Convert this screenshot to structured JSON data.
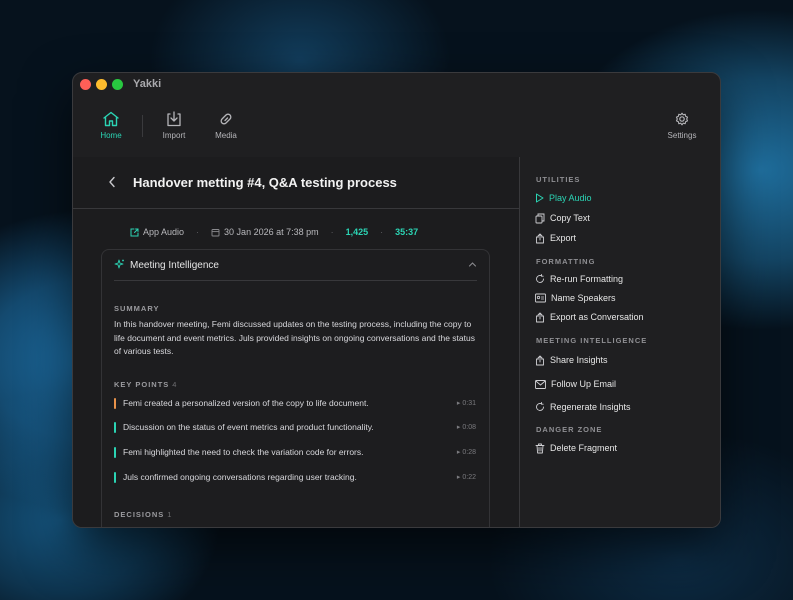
{
  "app": {
    "title": "Yakki"
  },
  "toolbar": {
    "home": "Home",
    "import": "Import",
    "media": "Media",
    "settings": "Settings"
  },
  "header": {
    "title": "Handover metting #4, Q&A testing process"
  },
  "meta": {
    "source": "App Audio",
    "date": "30 Jan 2026 at 7:38 pm",
    "words": "1,425",
    "duration": "35:37"
  },
  "intel": {
    "title": "Meeting Intelligence",
    "summary_label": "SUMMARY",
    "summary": "In this handover meeting, Femi discussed updates on the testing process, including the copy to life document and event metrics. Juls provided insights on ongoing conversations and the status of various tests.",
    "keypoints_label": "KEY POINTS",
    "keypoints_count": "4",
    "keypoints": [
      {
        "text": "Femi created a personalized version of the copy to life document.",
        "time": "0:31",
        "color": "#e8924a"
      },
      {
        "text": "Discussion on the status of event metrics and product functionality.",
        "time": "0:08",
        "color": "#2bd4b4"
      },
      {
        "text": "Femi highlighted the need to check the variation code for errors.",
        "time": "0:28",
        "color": "#2bd4b4"
      },
      {
        "text": "Juls confirmed ongoing conversations regarding user tracking.",
        "time": "0:22",
        "color": "#2bd4b4"
      }
    ],
    "decisions_label": "DECISIONS",
    "decisions_count": "1"
  },
  "sidebar": {
    "utilities_label": "UTILITIES",
    "play_audio": "Play Audio",
    "copy_text": "Copy Text",
    "export": "Export",
    "formatting_label": "FORMATTING",
    "rerun": "Re-run Formatting",
    "name_speakers": "Name Speakers",
    "export_conv": "Export as Conversation",
    "mi_label": "MEETING INTELLIGENCE",
    "share": "Share Insights",
    "follow_up": "Follow Up Email",
    "regenerate": "Regenerate Insights",
    "danger_label": "DANGER ZONE",
    "delete": "Delete Fragment"
  },
  "colors": {
    "accent": "#2bd4b4",
    "orange": "#e8924a"
  }
}
